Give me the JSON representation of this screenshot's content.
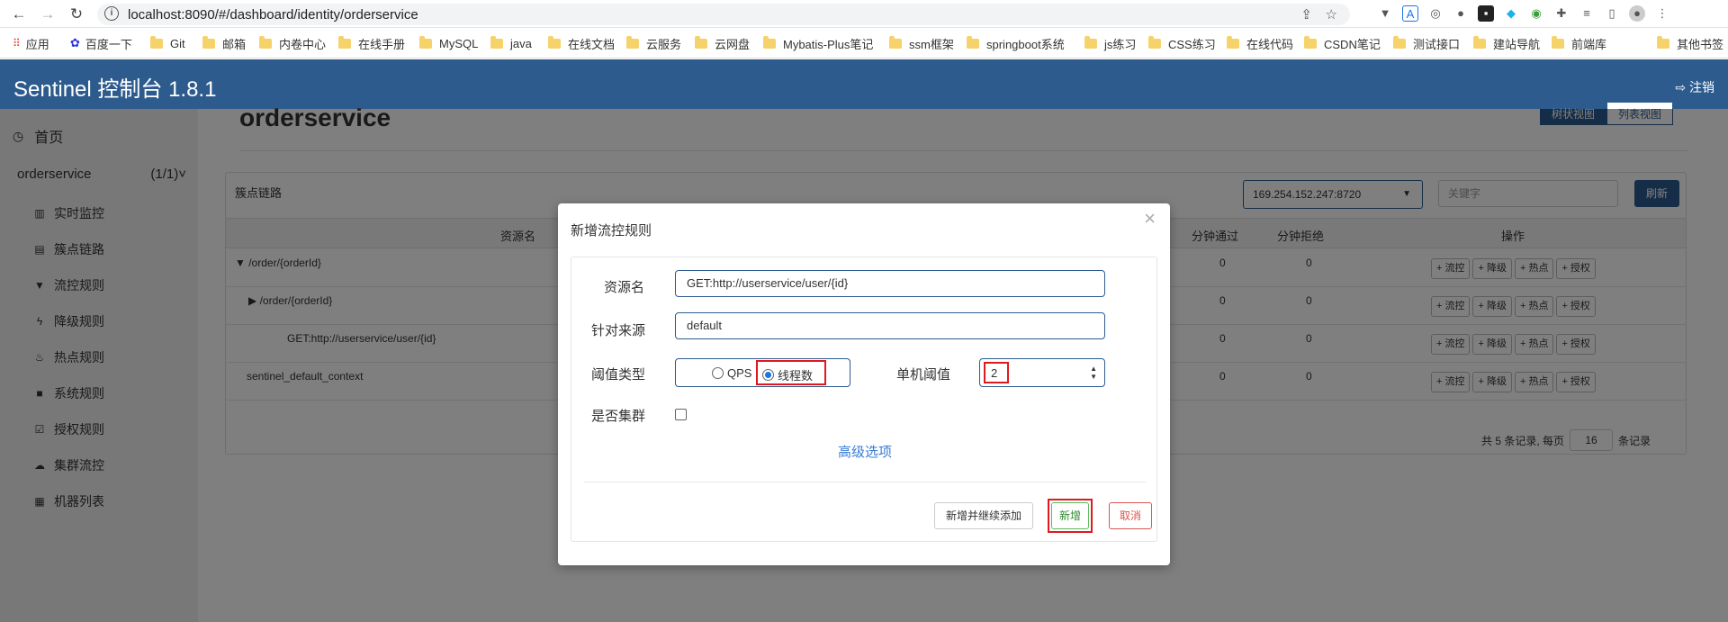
{
  "browser": {
    "url": "localhost:8090/#/dashboard/identity/orderservice",
    "bookmarks": [
      "应用",
      "百度一下",
      "Git",
      "邮箱",
      "内卷中心",
      "在线手册",
      "MySQL",
      "java",
      "在线文档",
      "云服务",
      "云网盘",
      "Mybatis-Plus笔记",
      "ssm框架",
      "springboot系统",
      "js练习",
      "CSS练习",
      "在线代码",
      "CSDN笔记",
      "测试接口",
      "建站导航",
      "前端库",
      "其他书签"
    ]
  },
  "header": {
    "title": "Sentinel 控制台 1.8.1",
    "logout": "注销"
  },
  "sidebar": {
    "home": "首页",
    "app_name": "orderservice",
    "app_count": "(1/1)",
    "items": [
      {
        "label": "实时监控",
        "icon": "chart-icon"
      },
      {
        "label": "簇点链路",
        "icon": "list-icon"
      },
      {
        "label": "流控规则",
        "icon": "filter-icon"
      },
      {
        "label": "降级规则",
        "icon": "bolt-icon"
      },
      {
        "label": "热点规则",
        "icon": "fire-icon"
      },
      {
        "label": "系统规则",
        "icon": "lock-icon"
      },
      {
        "label": "授权规则",
        "icon": "check-icon"
      },
      {
        "label": "集群流控",
        "icon": "cloud-icon"
      },
      {
        "label": "机器列表",
        "icon": "grid-icon"
      }
    ]
  },
  "main": {
    "title": "orderservice",
    "view_tree": "树状视图",
    "view_list": "列表视图",
    "panel_title": "簇点链路",
    "machine": "169.254.152.247:8720",
    "keyword_placeholder": "关键字",
    "refresh": "刷新",
    "columns": {
      "resource": "资源名",
      "pass_min": "分钟通过",
      "block_min": "分钟拒绝",
      "ops": "操作"
    },
    "rows": [
      {
        "name": "/order/{orderId}",
        "pass": "0",
        "block": "0"
      },
      {
        "name": "/order/{orderId}",
        "pass": "0",
        "block": "0"
      },
      {
        "name": "GET:http://userservice/user/{id}",
        "pass": "0",
        "block": "0"
      },
      {
        "name": "sentinel_default_context",
        "pass": "0",
        "block": "0"
      }
    ],
    "op_buttons": [
      "+ 流控",
      "+ 降级",
      "+ 热点",
      "+ 授权"
    ],
    "pager": {
      "prefix": "共 5 条记录, 每页",
      "page_size": "16",
      "suffix": "条记录"
    }
  },
  "modal": {
    "title": "新增流控规则",
    "resource_label": "资源名",
    "resource_value": "GET:http://userservice/user/{id}",
    "source_label": "针对来源",
    "source_value": "default",
    "threshold_type_label": "阈值类型",
    "opt_qps": "QPS",
    "opt_thread": "线程数",
    "selected_type": "线程数",
    "single_threshold_label": "单机阈值",
    "single_threshold_value": "2",
    "cluster_label": "是否集群",
    "advanced": "高级选项",
    "btn_add_continue": "新增并继续添加",
    "btn_add": "新增",
    "btn_cancel": "取消"
  },
  "colors": {
    "brand": "#2d5b8e",
    "highlight": "#e0191e",
    "add": "#5cb85c",
    "cancel": "#d9534f"
  }
}
